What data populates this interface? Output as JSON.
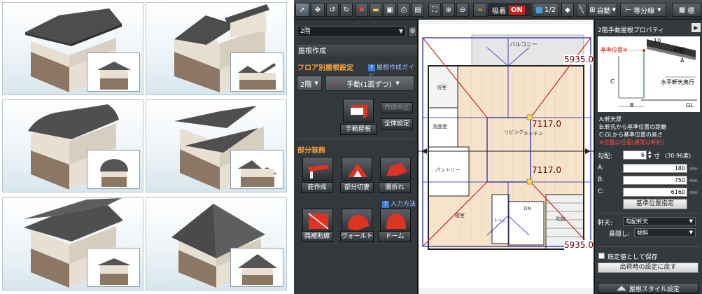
{
  "toolbar": {
    "snap_label": "吸着",
    "snap_state": "ON",
    "scale": "1/2",
    "mode": "自動",
    "divide": "等分線",
    "standard": "標"
  },
  "left_panel": {
    "floor": "2階",
    "section_title": "屋根作成",
    "floor_roof_setting": "フロア別屋根設定",
    "roof_guide": "屋根作成ガイド",
    "floor_select": "2階",
    "mode_select": "手動(1面ずつ)",
    "manual_roof": "手動屋根",
    "cancel_create": "作成中止",
    "global_setting": "全体設定",
    "partial_decoration": "部分装飾",
    "eaves_create": "庇作成",
    "partial_gable": "部分切妻",
    "waist_fold": "腰折れ",
    "input_method": "入力方法",
    "aux_line": "隅補助線",
    "vault": "ヴォールト",
    "dome": "ドーム"
  },
  "plan": {
    "balcony": "バルコニー",
    "bath": "浴室",
    "washroom": "洗面室",
    "living": "リビング",
    "kitchen": "キッチン",
    "pantry": "パントリー",
    "bedroom": "寝室",
    "toilet": "トイレ",
    "dn": "DN",
    "hall": "吹抜",
    "dim_top": "5935.0",
    "dim_mid1": "7117.0",
    "dim_mid2": "7117.0",
    "dim_bottom": "5935.0"
  },
  "right_panel": {
    "title": "2階手動屋根プロパティ",
    "diagram": {
      "base_label": "基準位置※",
      "pitch_val": "10",
      "pitch_label": "勾配",
      "a": "A",
      "c": "C",
      "b": "B",
      "eave": "水平軒天奥行",
      "gl": "GL"
    },
    "legend_a": "A:軒天厚",
    "legend_b": "B:軒先から基準位置の距離",
    "legend_c": "C:GLから基準位置の高さ",
    "legend_note": "※位置は任意(通常は軒桁)",
    "pitch_label": "勾配:",
    "pitch_value": "6",
    "pitch_unit": "寸",
    "pitch_deg": "(30.96度)",
    "a_label": "A:",
    "a_value": "180",
    "b_label": "B:",
    "b_value": "750",
    "c_label": "C:",
    "c_value": "6160",
    "mm": "mm",
    "base_btn": "基準位置指定",
    "soffit_label": "軒天:",
    "soffit_value": "勾配軒天",
    "nose_label": "鼻隠し:",
    "nose_value": "傾斜",
    "save_default": "既定値として保存",
    "reset_btn": "出荷時の設定に戻す",
    "style_btn": "屋根スタイル設定"
  },
  "colors": {
    "accent_orange": "#f2a23a",
    "snap_red": "#d41d1d",
    "plan_line": "#1a1aa8",
    "hip_red": "#c8281e"
  }
}
